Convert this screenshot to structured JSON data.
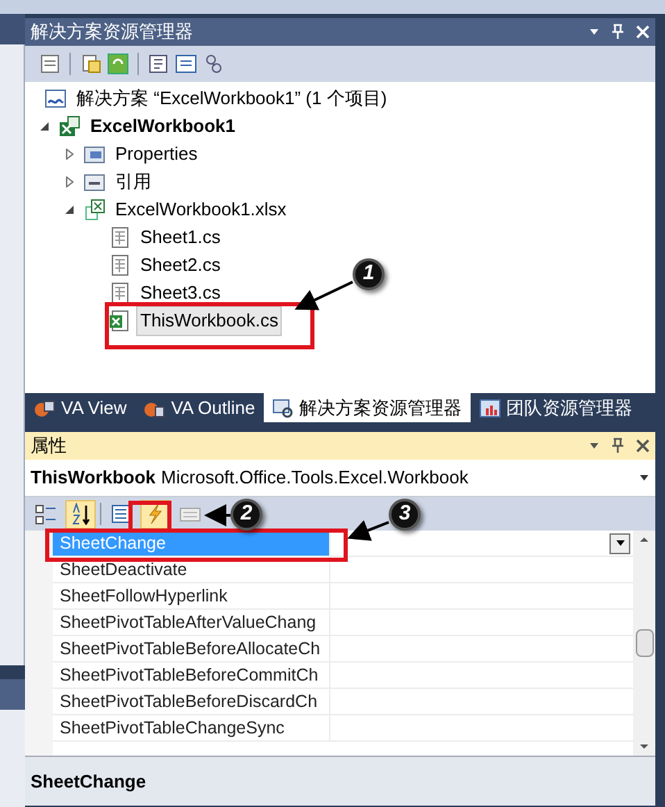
{
  "solution_explorer": {
    "title": "解决方案资源管理器",
    "tree": [
      {
        "label": "解决方案 “ExcelWorkbook1” (1 个项目)",
        "kind": "solution",
        "children": [
          {
            "label": "ExcelWorkbook1",
            "kind": "project",
            "expanded": true,
            "children": [
              {
                "label": "Properties",
                "kind": "folder",
                "expanded": false
              },
              {
                "label": "引用",
                "kind": "references",
                "expanded": false
              },
              {
                "label": "ExcelWorkbook1.xlsx",
                "kind": "workbook",
                "expanded": true,
                "children": [
                  {
                    "label": "Sheet1.cs",
                    "kind": "sheet",
                    "selected": false
                  },
                  {
                    "label": "Sheet2.cs",
                    "kind": "sheet",
                    "selected": false
                  },
                  {
                    "label": "Sheet3.cs",
                    "kind": "sheet",
                    "selected": false
                  },
                  {
                    "label": "ThisWorkbook.cs",
                    "kind": "excel",
                    "selected": true
                  }
                ]
              }
            ]
          }
        ]
      }
    ]
  },
  "tabs": [
    {
      "label": "VA View",
      "selected": false
    },
    {
      "label": "VA Outline",
      "selected": false
    },
    {
      "label": "解决方案资源管理器",
      "selected": true
    },
    {
      "label": "团队资源管理器",
      "selected": false
    }
  ],
  "properties": {
    "title": "属性",
    "object_name": "ThisWorkbook",
    "object_type": "Microsoft.Office.Tools.Excel.Workbook",
    "toolbar": [
      {
        "kind": "categorized",
        "selected": false
      },
      {
        "kind": "alphabetical",
        "selected": true
      },
      {
        "kind": "properties",
        "selected": false
      },
      {
        "kind": "events",
        "selected": true
      },
      {
        "kind": "pages",
        "selected": false
      }
    ],
    "events": [
      {
        "name": "SheetChange",
        "selected": true
      },
      {
        "name": "SheetDeactivate",
        "selected": false
      },
      {
        "name": "SheetFollowHyperlink",
        "selected": false
      },
      {
        "name": "SheetPivotTableAfterValueChang",
        "selected": false
      },
      {
        "name": "SheetPivotTableBeforeAllocateCh",
        "selected": false
      },
      {
        "name": "SheetPivotTableBeforeCommitCh",
        "selected": false
      },
      {
        "name": "SheetPivotTableBeforeDiscardCh",
        "selected": false
      },
      {
        "name": "SheetPivotTableChangeSync",
        "selected": false
      }
    ],
    "description": "SheetChange"
  },
  "callouts": [
    {
      "label": "1"
    },
    {
      "label": "2"
    },
    {
      "label": "3"
    }
  ]
}
